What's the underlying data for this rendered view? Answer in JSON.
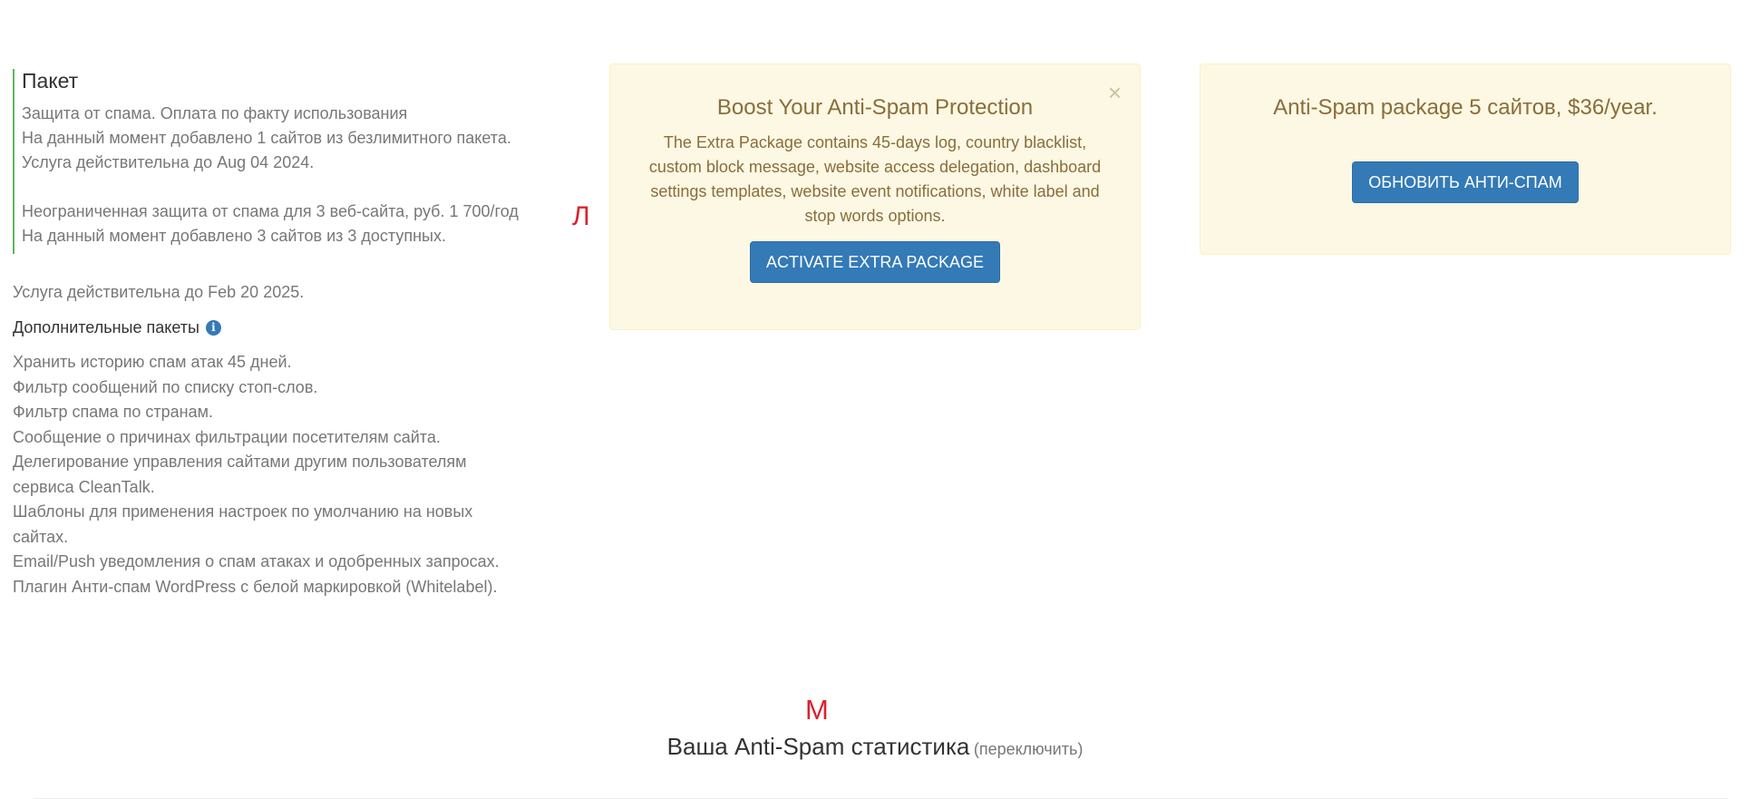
{
  "package": {
    "title": "Пакет",
    "line1": "Защита от спама. Оплата по факту использования",
    "line2": "На данный момент добавлено 1 сайтов из безлимитного пакета.",
    "line3": "Услуга действительна до Aug 04 2024.",
    "line4": "Неограниченная защита от спама для 3 веб-сайта, руб. 1 700/год",
    "line5": "На данный момент добавлено 3 сайтов из 3 доступных."
  },
  "markers": {
    "l": "Л",
    "m": "М"
  },
  "validity": "Услуга действительна до Feb 20 2025.",
  "extras": {
    "title": "Дополнительные пакеты",
    "info_icon": "i",
    "items": [
      "Хранить историю спам атак 45 дней.",
      "Фильтр сообщений по списку стоп-слов.",
      "Фильтр спама по странам.",
      "Сообщение о причинах фильтрации посетителям сайта.",
      "Делегирование управления сайтами другим пользователям",
      "сервиса CleanTalk.",
      "Шаблоны для применения настроек по умолчанию на новых",
      "сайтах.",
      "Email/Push уведомления о спам атаках и одобренных запросах.",
      "Плагин Анти-спам WordPress с белой маркировкой (Whitelabel)."
    ]
  },
  "extra_panel": {
    "title": "Boost Your Anti-Spam Protection",
    "text": "The Extra Package contains 45-days log, country blacklist, custom block message, website access delegation, dashboard settings templates, website event notifications, white label and stop words options.",
    "button": "ACTIVATE EXTRA PACKAGE",
    "close": "×"
  },
  "upgrade_panel": {
    "title": "Anti-Spam package 5 сайтов, $36/year.",
    "button": "ОБНОВИТЬ АНТИ-СПАМ"
  },
  "stats": {
    "title": "Ваша Anti-Spam статистика",
    "toggle": "(переключить)"
  },
  "colors": {
    "primary_button": "#337ab7",
    "warning_bg": "#fcf8e3",
    "warning_text": "#8a6d3b",
    "accent_border": "#5cb85c",
    "marker": "#d9232e"
  }
}
